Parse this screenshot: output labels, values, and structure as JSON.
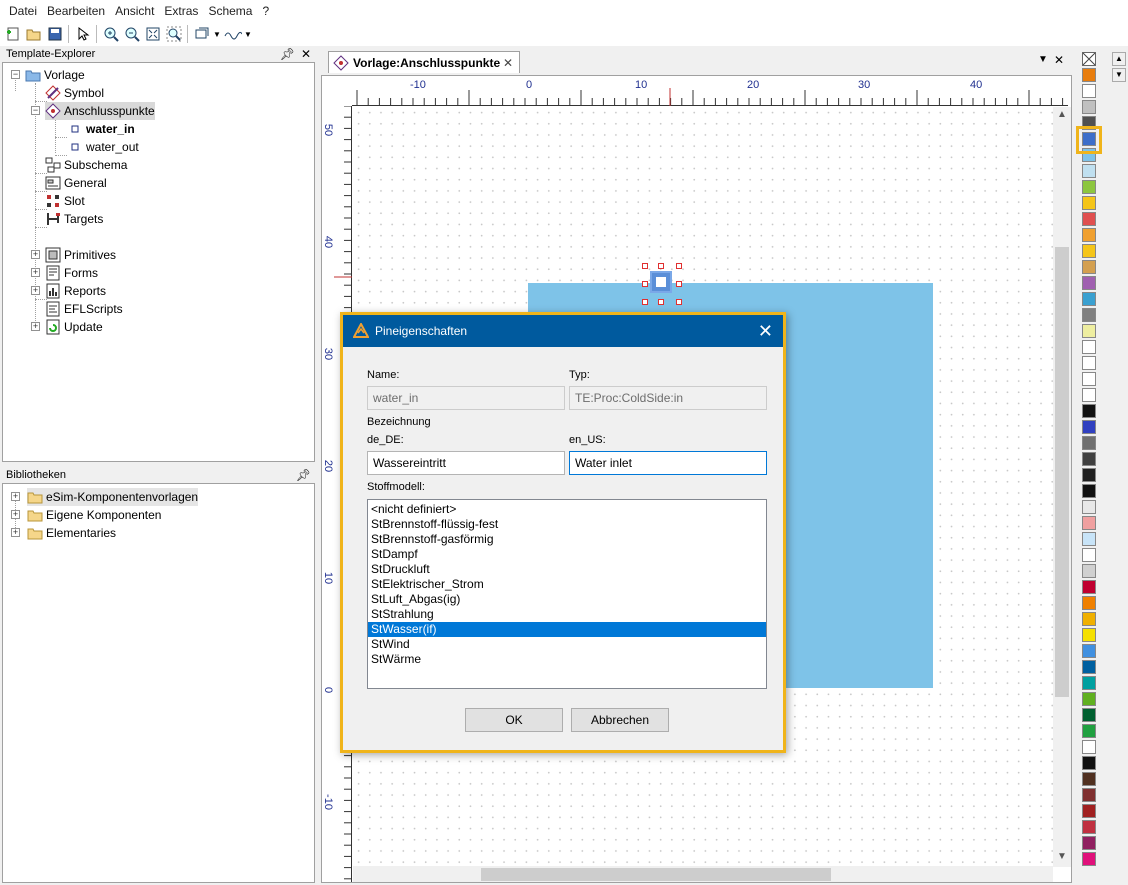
{
  "menu": [
    "Datei",
    "Bearbeiten",
    "Ansicht",
    "Extras",
    "Schema",
    "?"
  ],
  "template_explorer": {
    "title": "Template-Explorer",
    "nodes": {
      "vorlage": "Vorlage",
      "symbol": "Symbol",
      "anschlusspunkte": "Anschlusspunkte",
      "water_in": "water_in",
      "water_out": "water_out",
      "subschema": "Subschema",
      "general": "General",
      "slot": "Slot",
      "targets": "Targets",
      "primitives": "Primitives",
      "forms": "Forms",
      "reports": "Reports",
      "eflscripts": "EFLScripts",
      "update": "Update"
    }
  },
  "bibliotheken": {
    "title": "Bibliotheken",
    "items": [
      "eSim-Komponentenvorlagen",
      "Eigene Komponenten",
      "Elementaries"
    ]
  },
  "document_tab": {
    "label": "Vorlage:Anschlusspunkte"
  },
  "ruler": {
    "h_labels": [
      "-10",
      "0",
      "10",
      "20",
      "30",
      "40"
    ],
    "v_labels": [
      "50",
      "40",
      "30",
      "20",
      "10",
      "0",
      "-10"
    ]
  },
  "palette_colors": [
    "#e87d0d",
    "#ffffff",
    "#c0c0c0",
    "#505050",
    "#3d6ec9",
    "#7ec3e8",
    "#c0e0f0",
    "#8dc63f",
    "#f5c518",
    "#e05050",
    "#f0a030",
    "#f5c518",
    "#d4a050",
    "#a060b0",
    "#3aa0d0",
    "#808080",
    "#eeeea0",
    "#ffffff",
    "#ffffff",
    "#ffffff",
    "#ffffff",
    "#111111",
    "#3040c0",
    "#707070",
    "#404040",
    "#202020",
    "#111111",
    "#e8e8e8",
    "#f0a0a0",
    "#c8e4f8",
    "#ffffff",
    "#d0d0d0",
    "#c00030",
    "#f08000",
    "#f0b000",
    "#f5e000",
    "#4090e0",
    "#0060a0",
    "#00a0a0",
    "#60b020",
    "#006030",
    "#20a040",
    "#ffffff",
    "#111111",
    "#503020",
    "#803030",
    "#a02020",
    "#c03040",
    "#902060",
    "#e0107a"
  ],
  "dialog": {
    "title": "Pineigenschaften",
    "name_label": "Name:",
    "name_value": "water_in",
    "typ_label": "Typ:",
    "typ_value": "TE:Proc:ColdSide:in",
    "bezeichnung_label": "Bezeichnung",
    "de_label": "de_DE:",
    "de_value": "Wassereintritt",
    "en_label": "en_US:",
    "en_value": "Water inlet",
    "stoffmodell_label": "Stoffmodell:",
    "stoffmodell_options": [
      "<nicht definiert>",
      "StBrennstoff-flüssig-fest",
      "StBrennstoff-gasförmig",
      "StDampf",
      "StDruckluft",
      "StElektrischer_Strom",
      "StLuft_Abgas(ig)",
      "StStrahlung",
      "StWasser(if)",
      "StWind",
      "StWärme"
    ],
    "stoffmodell_selected": "StWasser(if)",
    "ok_label": "OK",
    "cancel_label": "Abbrechen"
  }
}
